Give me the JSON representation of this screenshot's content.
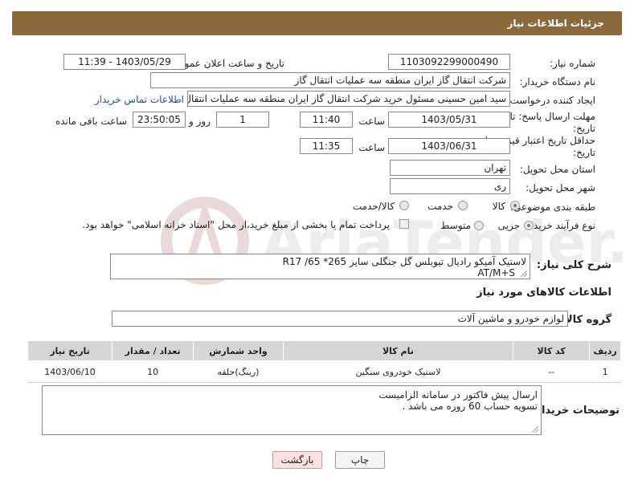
{
  "header": {
    "title": "جزئیات اطلاعات نیاز"
  },
  "form": {
    "need_number_label": "شماره نیاز:",
    "need_number": "1103092299000490",
    "announce_label": "تاریخ و ساعت اعلان عمومی:",
    "announce_value": "1403/05/29 - 11:39",
    "buyer_org_label": "نام دستگاه خریدار:",
    "buyer_org": "شرکت انتقال گاز ایران منطقه سه عملیات انتقال گاز",
    "requester_label": "ایجاد کننده درخواست:",
    "requester": "سید امین حسینی مسئول خرید شرکت انتقال گاز ایران منطقه سه عملیات انتقال گاز",
    "contact_link": "اطلاعات تماس خریدار",
    "deadline_label_1": "مهلت ارسال پاسخ: تا",
    "deadline_label_2": "تاریخ:",
    "deadline_date": "1403/05/31",
    "time_label": "ساعت",
    "deadline_time": "11:40",
    "days_value": "1",
    "days_label": "روز و",
    "remaining_time": "23:50:05",
    "remaining_label": "ساعت باقی مانده",
    "validity_label_1": "حداقل تاریخ اعتبار قیمت: تا",
    "validity_label_2": "تاریخ:",
    "validity_date": "1403/06/31",
    "validity_time": "11:35",
    "province_label": "استان محل تحویل:",
    "province": "تهران",
    "city_label": "شهر محل تحویل:",
    "city": "ری",
    "category_label": "طبقه بندی موضوعی:",
    "category_options": [
      "کالا",
      "خدمت",
      "کالا/خدمت"
    ],
    "process_label": "نوع فرآیند خرید :",
    "process_options": [
      "جزیی",
      "متوسط"
    ],
    "payment_note": "پرداخت تمام یا بخشی از مبلغ خرید،از محل \"اسناد خزانه اسلامی\" خواهد بود."
  },
  "description": {
    "label": "شرح کلی نیاز:",
    "line1": "لاستیک آمیکو رادیال تیوبلس گل جنگلی سایز  265* 65/  R17",
    "line2": "AT/M+S"
  },
  "goods_section": {
    "title": "اطلاعات کالاهای مورد نیاز",
    "group_label": "گروه کالا:",
    "group_value": "لوازم خودرو و ماشین آلات"
  },
  "table": {
    "headers": [
      "ردیف",
      "کد کالا",
      "نام کالا",
      "واحد شمارش",
      "تعداد / مقدار",
      "تاریخ نیاز"
    ],
    "rows": [
      [
        "1",
        "--",
        "لاستیک خودروی سنگین",
        "(رینگ)حلقه",
        "10",
        "1403/06/10"
      ]
    ]
  },
  "buyer_notes": {
    "label": "توضیحات خریدار:",
    "line1": "ارسال پیش فاکتور در سامانه الزامیست",
    "line2": "تسویه حساب 60 روزه می باشد ."
  },
  "buttons": {
    "print": "چاپ",
    "back": "بازگشت"
  },
  "watermark": "AriaTender.net",
  "colors": {
    "header_bg": "#8a6a3a",
    "link": "#1a4ea8"
  }
}
